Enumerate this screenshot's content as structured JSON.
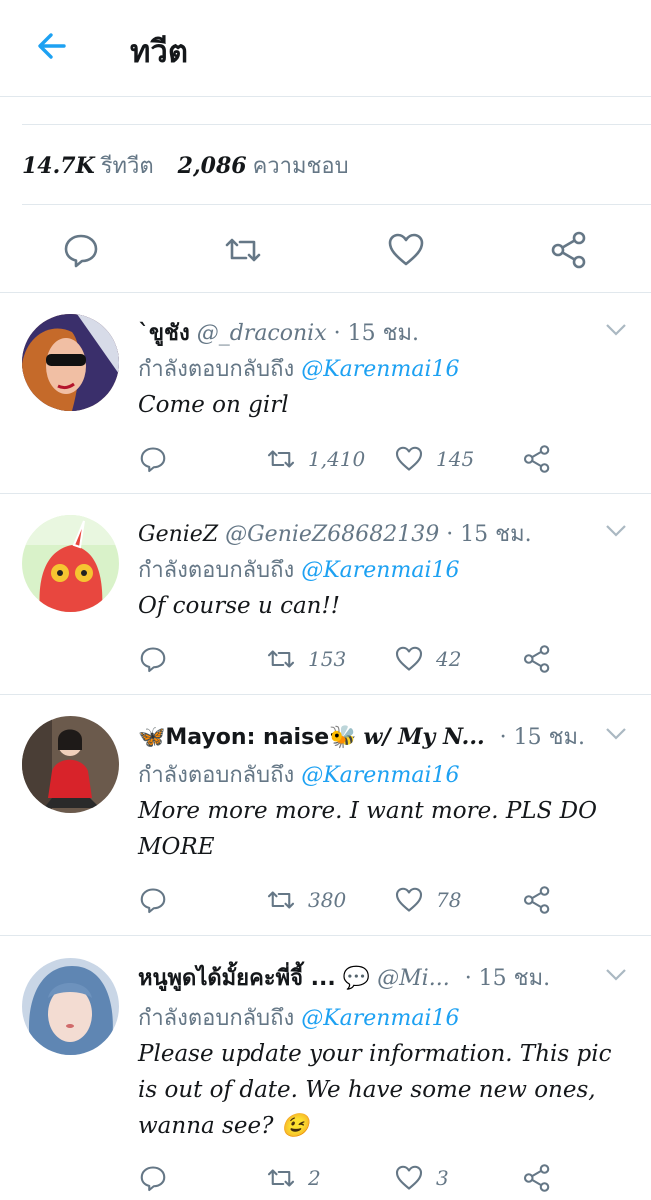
{
  "header": {
    "title": "ทวีต"
  },
  "stats": {
    "retweets_count": "14.7K",
    "retweets_label": "รีทวีต",
    "likes_count": "2,086",
    "likes_label": "ความชอบ"
  },
  "colors": {
    "accent": "#1da1f2",
    "muted": "#657786",
    "border": "#e1e8ed"
  },
  "replies": [
    {
      "name": "`ขูชัง",
      "handle": "@_draconix",
      "time": "· 15 ชม.",
      "replying_label": "กำลังตอบกลับถึง",
      "mention": "@Karenmai16",
      "text": "Come on girl",
      "retweets": "1,410",
      "likes": "145"
    },
    {
      "name": "GenieZ",
      "handle": "@GenieZ68682139",
      "time": "· 15 ชม.",
      "replying_label": "กำลังตอบกลับถึง",
      "mention": "@Karenmai16",
      "text": "Of course u can!!",
      "retweets": "153",
      "likes": "42"
    },
    {
      "name_prefix": "🦋",
      "name": "Mayon",
      "name_mid": ": naise",
      "name_suffix": "🐝",
      "handle": "w/ My N...",
      "time": "· 15 ชม.",
      "replying_label": "กำลังตอบกลับถึง",
      "mention": "@Karenmai16",
      "text": "More more more. I want more. PLS DO MORE",
      "retweets": "380",
      "likes": "78"
    },
    {
      "name": "หนูพูดได้มั้ยคะพี่จี้ ...",
      "name_suffix": "💬",
      "handle": "@Mi...",
      "time": "· 15 ชม.",
      "replying_label": "กำลังตอบกลับถึง",
      "mention": "@Karenmai16",
      "text": "Please update your information. This pic is out of date. We have some new ones, wanna see? 😉",
      "retweets": "2",
      "likes": "3"
    }
  ]
}
